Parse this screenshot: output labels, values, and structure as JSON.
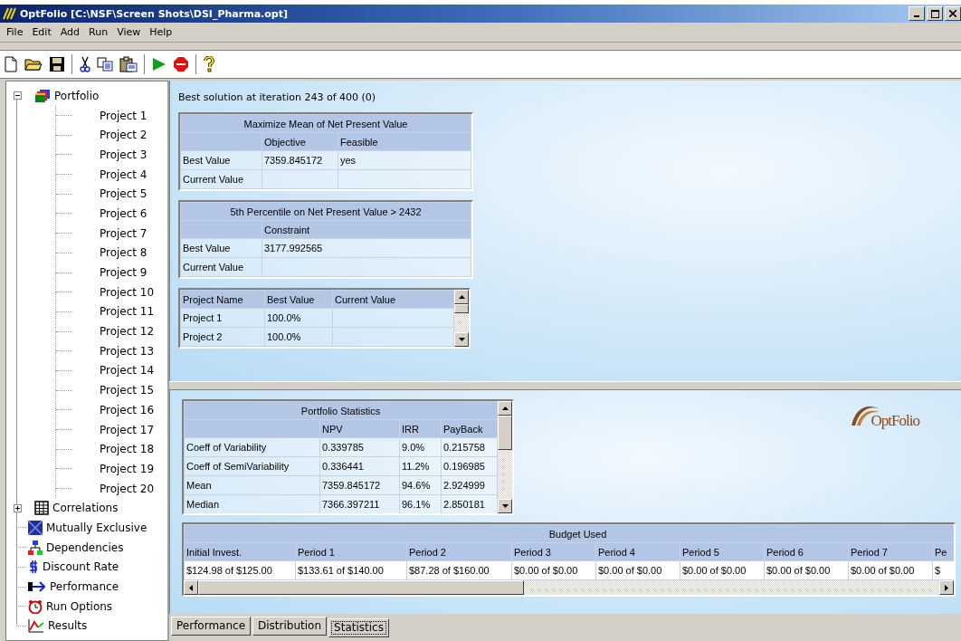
{
  "window": {
    "title": "OptFolio  [C:\\NSF\\Screen Shots\\DSI_Pharma.opt]"
  },
  "menu": [
    "File",
    "Edit",
    "Add",
    "Run",
    "View",
    "Help"
  ],
  "tree": [
    {
      "label": "Portfolio",
      "expanded": true,
      "children": [
        {
          "label": "Project 1"
        },
        {
          "label": "Project 2"
        },
        {
          "label": "Project 3"
        },
        {
          "label": "Project 4"
        },
        {
          "label": "Project 5"
        },
        {
          "label": "Project 6"
        },
        {
          "label": "Project 7"
        },
        {
          "label": "Project 8"
        },
        {
          "label": "Project 9"
        },
        {
          "label": "Project 10"
        },
        {
          "label": "Project 11"
        },
        {
          "label": "Project 12"
        },
        {
          "label": "Project 13"
        },
        {
          "label": "Project 14"
        },
        {
          "label": "Project 15"
        },
        {
          "label": "Project 16"
        },
        {
          "label": "Project 17"
        },
        {
          "label": "Project 18"
        },
        {
          "label": "Project 19"
        },
        {
          "label": "Project 20"
        }
      ]
    },
    {
      "label": "Correlations",
      "expanded": false
    },
    {
      "label": "Mutually Exclusive"
    },
    {
      "label": "Dependencies"
    },
    {
      "label": "Discount Rate"
    },
    {
      "label": "Performance"
    },
    {
      "label": "Run Options"
    },
    {
      "label": "Results"
    }
  ],
  "status_text": "Best solution at iteration 243 of 400 (0)",
  "objective_table": {
    "title": "Maximize Mean of Net Present Value",
    "columns": [
      "Objective",
      "Feasible"
    ],
    "rows": [
      {
        "label": "Best Value",
        "values": [
          "7359.845172",
          "yes"
        ]
      },
      {
        "label": "Current Value",
        "values": []
      }
    ]
  },
  "constraint_table": {
    "title": "5th Percentile on Net Present Value > 2432",
    "columns": [
      "Constraint"
    ],
    "rows": [
      {
        "label": "Best Value",
        "values": [
          "3177.992565"
        ]
      },
      {
        "label": "Current Value",
        "values": []
      }
    ]
  },
  "projects_table": {
    "columns": [
      "Project Name",
      "Best Value",
      "Current Value"
    ],
    "rows": [
      {
        "name": "Project 1",
        "best": "100.0%"
      },
      {
        "name": "Project 2",
        "best": "100.0%"
      }
    ]
  },
  "statistics_table": {
    "title": "Portfolio Statistics",
    "columns": [
      "NPV",
      "IRR",
      "PayBack"
    ],
    "rows": [
      {
        "label": "Coeff of Variability",
        "values": [
          "0.339785",
          "9.0%",
          "0.215758"
        ]
      },
      {
        "label": "Coeff of SemiVariability",
        "values": [
          "0.336441",
          "11.2%",
          "0.196985"
        ]
      },
      {
        "label": "Mean",
        "values": [
          "7359.845172",
          "94.6%",
          "2.924999"
        ]
      },
      {
        "label": "Median",
        "values": [
          "7366.397211",
          "96.1%",
          "2.850181"
        ]
      }
    ]
  },
  "logo": {
    "text": "OptFolio"
  },
  "budget_table": {
    "title": "Budget Used",
    "columns": [
      "Initial Invest.",
      "Period 1",
      "Period 2",
      "Period 3",
      "Period 4",
      "Period 5",
      "Period 6",
      "Period 7",
      "Pe"
    ],
    "values": [
      "$124.98 of $125.00",
      "$133.61 of $140.00",
      "$87.28 of $160.00",
      "$0.00 of $0.00",
      "$0.00 of $0.00",
      "$0.00 of $0.00",
      "$0.00 of $0.00",
      "$0.00 of $0.00",
      "$"
    ]
  },
  "tabs": [
    {
      "label": "Performance",
      "selected": false
    },
    {
      "label": "Distribution",
      "selected": false
    },
    {
      "label": "Statistics",
      "selected": true
    }
  ]
}
